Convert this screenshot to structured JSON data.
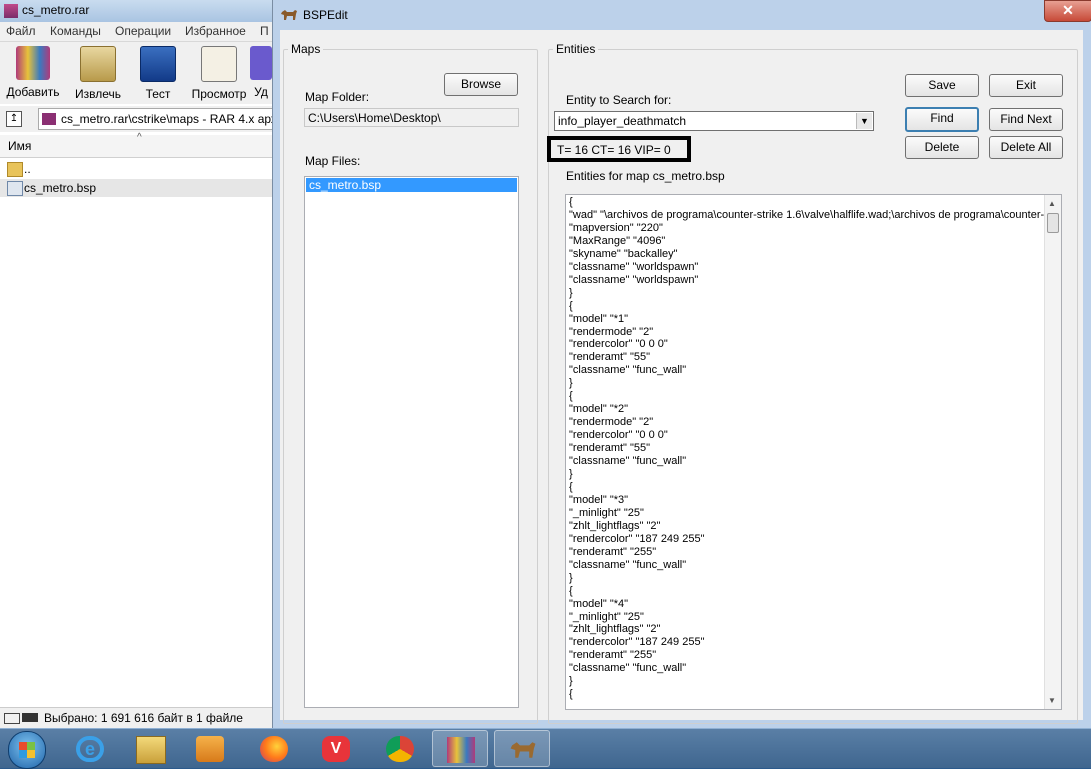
{
  "rar": {
    "title": "cs_metro.rar",
    "menu": [
      "Файл",
      "Команды",
      "Операции",
      "Избранное",
      "П"
    ],
    "toolbar": [
      {
        "label": "Добавить",
        "icon": "add-archive-icon"
      },
      {
        "label": "Извлечь",
        "icon": "extract-icon"
      },
      {
        "label": "Тест",
        "icon": "test-icon"
      },
      {
        "label": "Просмотр",
        "icon": "view-icon"
      },
      {
        "label": "Уд",
        "icon": "delete-icon"
      }
    ],
    "path": "cs_metro.rar\\cstrike\\maps - RAR 4.x арх",
    "column_header": "Имя",
    "files": [
      {
        "name": "..",
        "icon": "folder-icon"
      },
      {
        "name": "cs_metro.bsp",
        "icon": "file-icon"
      }
    ],
    "status": "Выбрано: 1 691 616 байт в 1 файле"
  },
  "bsp": {
    "title": "BSPEdit",
    "close_label": "✕",
    "maps": {
      "legend": "Maps",
      "browse_label": "Browse",
      "folder_label": "Map Folder:",
      "folder_value": "C:\\Users\\Home\\Desktop\\",
      "files_label": "Map Files:",
      "files": [
        "cs_metro.bsp"
      ]
    },
    "entities": {
      "legend": "Entities",
      "save_label": "Save",
      "exit_label": "Exit",
      "find_label": "Find",
      "find_next_label": "Find Next",
      "delete_label": "Delete",
      "delete_all_label": "Delete All",
      "search_label": "Entity to Search for:",
      "search_value": "info_player_deathmatch",
      "counts": "T= 16 CT= 16 VIP= 0",
      "list_label": "Entities for map cs_metro.bsp",
      "text": "{\n\"wad\" \"\\archivos de programa\\counter-strike 1.6\\valve\\halflife.wad;\\archivos de programa\\counter-\n\"mapversion\" \"220\"\n\"MaxRange\" \"4096\"\n\"skyname\" \"backalley\"\n\"classname\" \"worldspawn\"\n\"classname\" \"worldspawn\"\n}\n{\n\"model\" \"*1\"\n\"rendermode\" \"2\"\n\"rendercolor\" \"0 0 0\"\n\"renderamt\" \"55\"\n\"classname\" \"func_wall\"\n}\n{\n\"model\" \"*2\"\n\"rendermode\" \"2\"\n\"rendercolor\" \"0 0 0\"\n\"renderamt\" \"55\"\n\"classname\" \"func_wall\"\n}\n{\n\"model\" \"*3\"\n\"_minlight\" \"25\"\n\"zhlt_lightflags\" \"2\"\n\"rendercolor\" \"187 249 255\"\n\"renderamt\" \"255\"\n\"classname\" \"func_wall\"\n}\n{\n\"model\" \"*4\"\n\"_minlight\" \"25\"\n\"zhlt_lightflags\" \"2\"\n\"rendercolor\" \"187 249 255\"\n\"renderamt\" \"255\"\n\"classname\" \"func_wall\"\n}\n{"
    }
  },
  "taskbar": {
    "items": [
      "start-button",
      "internet-explorer-icon",
      "file-explorer-icon",
      "media-player-icon",
      "firefox-icon",
      "vivaldi-icon",
      "chrome-icon",
      "winrar-icon",
      "bspedit-icon"
    ]
  }
}
